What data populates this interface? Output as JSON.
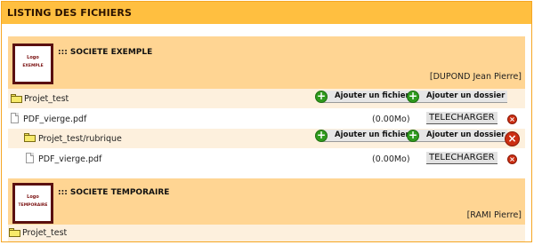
{
  "page_title": "LISTING DES FICHIERS",
  "companies": [
    {
      "logo_line1": "Logo",
      "logo_line2": "EXEMPLE",
      "name": "::: SOCIETE EXEMPLE",
      "user": "[DUPOND Jean Pierre]"
    },
    {
      "logo_line1": "Logo",
      "logo_line2": "TEMPORAIRE",
      "name": "::: SOCIETE TEMPORAIRE",
      "user": "[RAMI Pierre]"
    }
  ],
  "rows": [
    {
      "type": "folder",
      "name": "Projet_test",
      "add_file": "Ajouter un fichier",
      "add_folder": "Ajouter un dossier"
    },
    {
      "type": "file",
      "name": "PDF_vierge.pdf",
      "size": "(0.00Mo)",
      "download": "TELECHARGER"
    },
    {
      "type": "folder",
      "name": "Projet_test/rubrique",
      "add_file": "Ajouter un fichier",
      "add_folder": "Ajouter un dossier"
    },
    {
      "type": "file",
      "name": "PDF_vierge.pdf",
      "size": "(0.00Mo)",
      "download": "TELECHARGER"
    },
    {
      "type": "folder",
      "name": "Projet_test"
    }
  ],
  "icons": {
    "add": "plus-circle-icon",
    "delete": "delete-x-icon",
    "folder": "folder-icon",
    "file": "file-icon"
  },
  "colors": {
    "title_bar": "#ffbf40",
    "company_header": "#ffd593",
    "row_shade": "#fdf0dd",
    "add_green": "#2f9a1d",
    "delete_red": "#cc2e12"
  }
}
